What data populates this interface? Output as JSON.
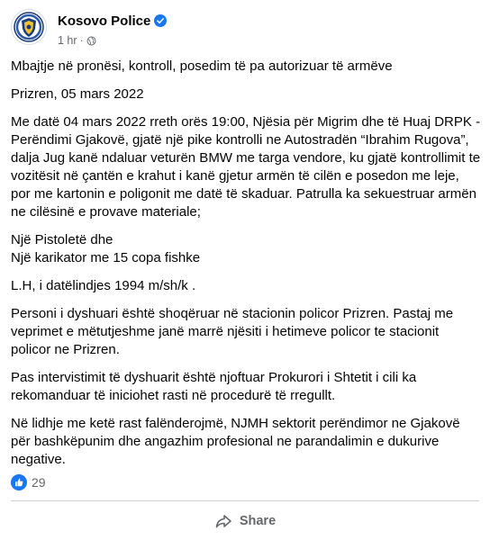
{
  "post": {
    "page_name": "Kosovo Police",
    "time": "1 hr",
    "separator": "·",
    "paragraphs": {
      "title": "Mbajtje në pronësi, kontroll, posedim të pa autorizuar të armëve",
      "place_date": "Prizren, 05 mars 2022",
      "p1": "Me datë 04 mars 2022 rreth orës 19:00, Njësia për Migrim dhe të Huaj DRPK - Perëndimi Gjakovë, gjatë një pike kontrolli ne Autostradën “Ibrahim Rugova”, dalja Jug kanë ndaluar veturën BMW me targa vendore, ku gjatë kontrollimit te vozitësit në çantën e krahut i kanë gjetur armën të cilën e posedon me leje, por me kartonin e poligonit me datë të skaduar. Patrulla ka sekuestruar armën ne cilësinë e provave materiale;",
      "item1": "Një Pistoletë dhe",
      "item2": "Një karikator me 15 copa fishke",
      "suspect": "L.H, i datëlindjes 1994 m/sh/k .",
      "p2": "Personi i dyshuari është shoqëruar në stacionin policor Prizren. Pastaj me veprimet e mëtutjeshme janë marrë njësiti i hetimeve policor te stacionit policor ne Prizren.",
      "p3": "Pas intervistimit të dyshuarit është njoftuar Prokurori i Shtetit i cili ka rekomanduar të iniciohet rasti në procedurë të rregullt.",
      "p4": "Në lidhje me ketë rast falënderojmë, NJMH sektorit perëndimor ne Gjakovë për bashkëpunim dhe angazhim profesional ne parandalimin e dukurive negative."
    },
    "reactions": {
      "count": "29"
    },
    "actions": {
      "share_label": "Share"
    }
  },
  "colors": {
    "text": "#050505",
    "meta": "#65676b",
    "like_blue": "#1877f2",
    "divider": "#ced0d4"
  },
  "icons": [
    "police-logo-icon",
    "verified-badge-icon",
    "globe-icon",
    "like-icon",
    "share-icon"
  ]
}
